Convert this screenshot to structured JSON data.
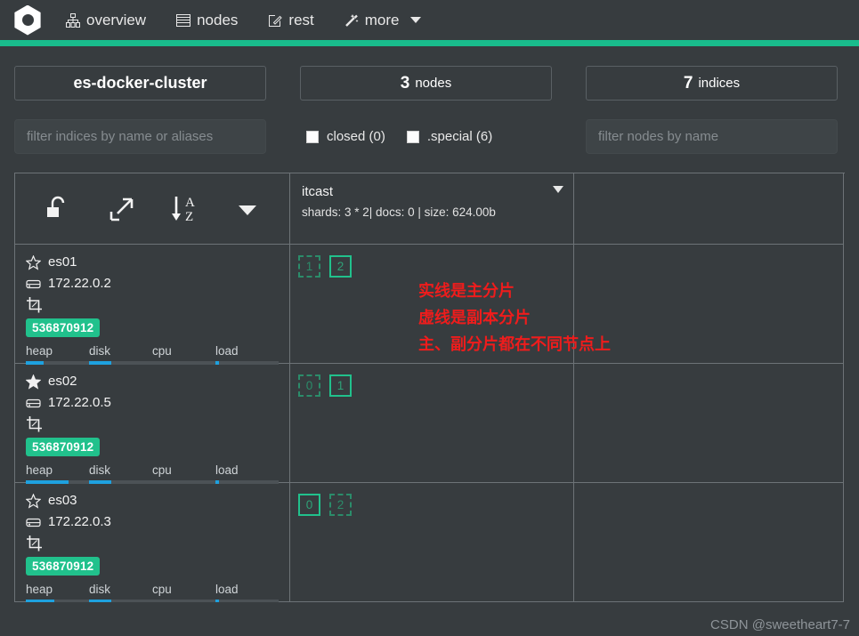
{
  "nav": {
    "logo_name": "elasticsearch-head-logo",
    "items": [
      {
        "label": "overview",
        "icon": "sitemap-icon"
      },
      {
        "label": "nodes",
        "icon": "server-list-icon"
      },
      {
        "label": "rest",
        "icon": "pencil-square-icon"
      },
      {
        "label": "more",
        "icon": "magic-wand-icon",
        "has_caret": true
      }
    ]
  },
  "summary": {
    "cluster_name": "es-docker-cluster",
    "nodes_count": "3",
    "nodes_label": "nodes",
    "indices_count": "7",
    "indices_label": "indices"
  },
  "filters": {
    "indices_placeholder": "filter indices by name or aliases",
    "indices_value": "",
    "nodes_placeholder": "filter nodes by name",
    "nodes_value": "",
    "closed_label": "closed (0)",
    "closed_checked": false,
    "special_label": ".special (6)",
    "special_checked": false
  },
  "toolbar": {
    "icons": [
      {
        "name": "unlock-icon",
        "title": "unlock"
      },
      {
        "name": "expand-arrows-icon",
        "title": "expand"
      },
      {
        "name": "sort-alpha-asc-icon",
        "title": "sort A-Z"
      },
      {
        "name": "chevron-down-icon",
        "title": "more"
      }
    ]
  },
  "index": {
    "name": "itcast",
    "meta": "shards: 3 * 2| docs: 0 | size: 624.00b"
  },
  "nodes": [
    {
      "name": "es01",
      "is_master": false,
      "ip": "172.22.0.2",
      "memory": "536870912",
      "meters": [
        {
          "label": "heap",
          "percent": 28
        },
        {
          "label": "disk",
          "percent": 35
        },
        {
          "label": "cpu",
          "percent": 0
        },
        {
          "label": "load",
          "percent": 6
        }
      ],
      "shards": [
        {
          "id": "1",
          "type": "replica"
        },
        {
          "id": "2",
          "type": "primary"
        }
      ]
    },
    {
      "name": "es02",
      "is_master": true,
      "ip": "172.22.0.5",
      "memory": "536870912",
      "meters": [
        {
          "label": "heap",
          "percent": 68
        },
        {
          "label": "disk",
          "percent": 35
        },
        {
          "label": "cpu",
          "percent": 0
        },
        {
          "label": "load",
          "percent": 6
        }
      ],
      "shards": [
        {
          "id": "0",
          "type": "replica"
        },
        {
          "id": "1",
          "type": "primary"
        }
      ]
    },
    {
      "name": "es03",
      "is_master": false,
      "ip": "172.22.0.3",
      "memory": "536870912",
      "meters": [
        {
          "label": "heap",
          "percent": 45
        },
        {
          "label": "disk",
          "percent": 35
        },
        {
          "label": "cpu",
          "percent": 0
        },
        {
          "label": "load",
          "percent": 6
        }
      ],
      "shards": [
        {
          "id": "0",
          "type": "primary"
        },
        {
          "id": "2",
          "type": "replica"
        }
      ]
    }
  ],
  "annotation": {
    "line1": "实线是主分片",
    "line2": "虚线是副本分片",
    "line3": "主、副分片都在不同节点上",
    "color": "#ef1c1c"
  },
  "watermark": "CSDN @sweetheart7-7",
  "colors": {
    "accent_green": "#19bc8c",
    "badge_green": "#21c18c",
    "meter_blue": "#1ea1df",
    "background": "#373c3f",
    "grid_line": "#6d7377"
  }
}
